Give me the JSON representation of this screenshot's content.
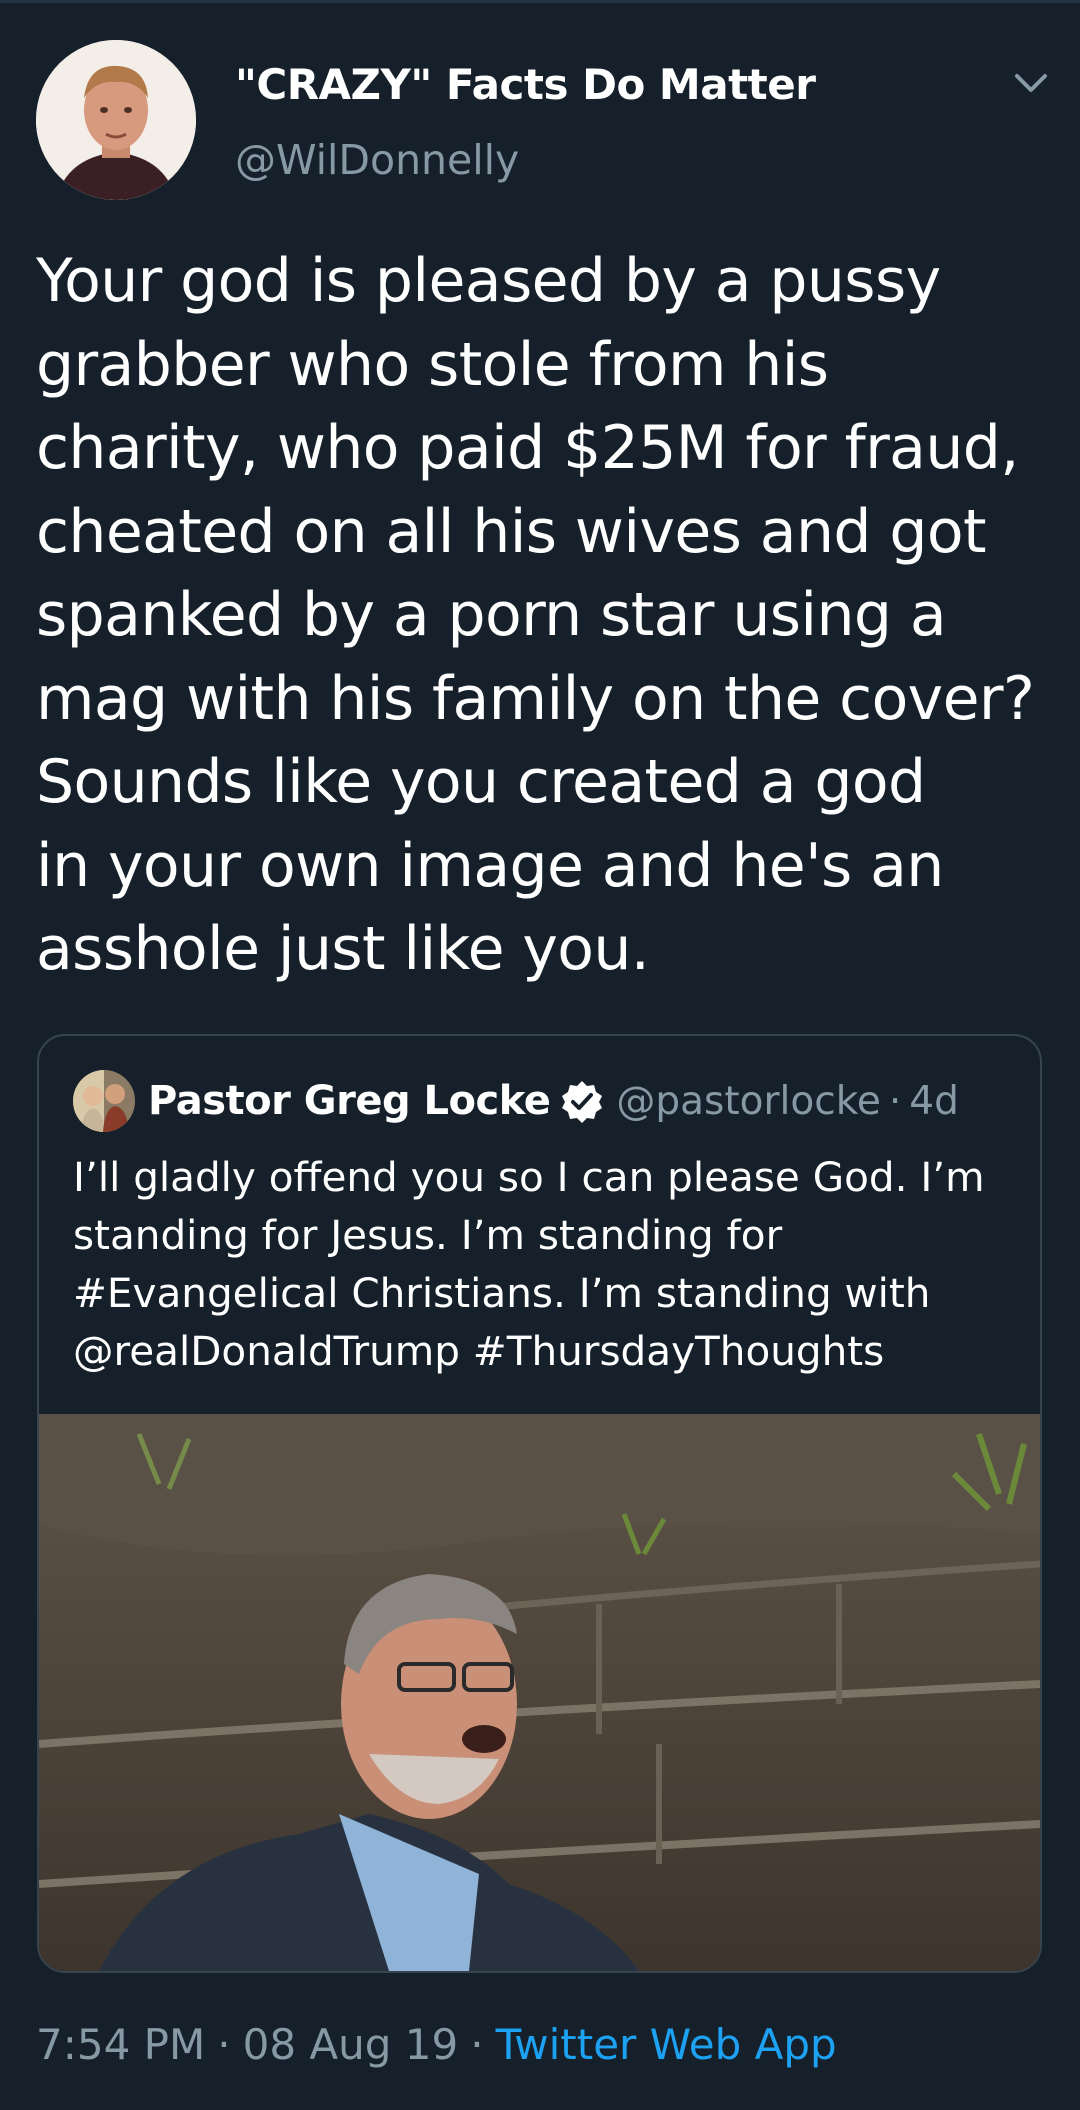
{
  "tweet": {
    "display_name": "\"CRAZY\" Facts Do Matter",
    "handle": "@WilDonnelly",
    "text": "Your god is pleased by a pussy\ngrabber who stole from his\ncharity, who paid $25M for fraud,\ncheated on all his wives and got\nspanked by a porn star using a\nmag with his family on the cover?\nSounds like you created a god\nin your own image and he's an\nasshole just like you.",
    "menu_icon": "chevron-down-icon"
  },
  "quoted_tweet": {
    "display_name": "Pastor Greg Locke",
    "verified_icon": "verified-badge-icon",
    "handle": "@pastorlocke",
    "separator": "·",
    "age": "4d",
    "text": "I’ll gladly offend you so I can please God. I’m\nstanding for Jesus. I’m standing for\n#Evangelical Christians. I’m standing with\n@realDonaldTrump #ThursdayThoughts"
  },
  "footer": {
    "time": "7:54 PM",
    "separator": "·",
    "date": "08 Aug 19",
    "source": "Twitter Web App"
  },
  "colors": {
    "background": "#15202b",
    "secondary_text": "#8899a6",
    "link": "#1da1f2",
    "border": "#38444d"
  }
}
